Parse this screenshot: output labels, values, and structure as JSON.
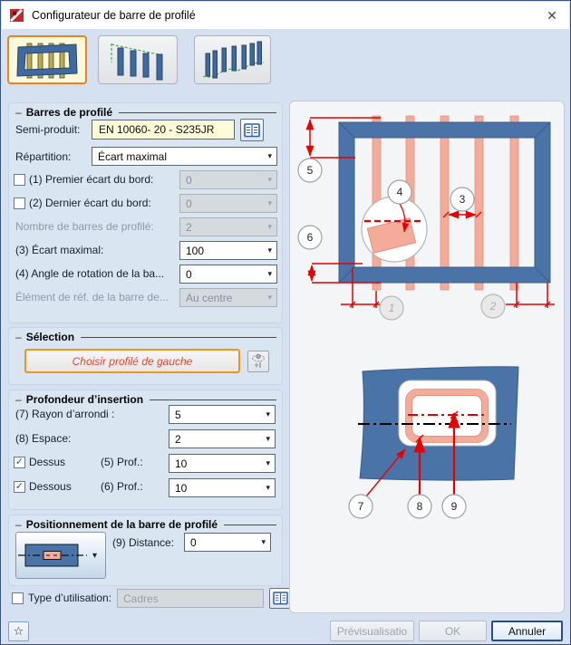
{
  "window": {
    "title": "Configurateur de barre de profilé"
  },
  "icons": {
    "chevron_down": "▾",
    "close": "✕",
    "star": "☆",
    "check": "✓",
    "plus_i": "+I"
  },
  "groups": {
    "bars": {
      "title": "Barres de profilé",
      "semi_product_label": "Semi-produit:",
      "semi_product_value": "EN 10060- 20 - S235JR",
      "repartition_label": "Répartition:",
      "repartition_value": "Écart maximal",
      "first_gap_label": "(1) Premier écart du bord:",
      "first_gap_value": "0",
      "last_gap_label": "(2) Dernier écart du bord:",
      "last_gap_value": "0",
      "count_label": "Nombre de barres de profilé:",
      "count_value": "2",
      "max_gap_label": "(3) Écart maximal:",
      "max_gap_value": "100",
      "angle_label": "(4) Angle de rotation de la ba...",
      "angle_value": "0",
      "ref_label": "Élément de réf. de la barre de...",
      "ref_value": "Au centre"
    },
    "selection": {
      "title": "Sélection",
      "choose_button": "Choisir profilé de gauche"
    },
    "depth": {
      "title": "Profondeur d’insertion",
      "radius_label": "(7) Rayon d’arrondi :",
      "radius_value": "5",
      "space_label": "(8) Espace:",
      "space_value": "2",
      "top_label": "Dessus",
      "top_prof_label": "(5) Prof.:",
      "top_prof_value": "10",
      "bottom_label": "Dessous",
      "bottom_prof_label": "(6) Prof.:",
      "bottom_prof_value": "10"
    },
    "positioning": {
      "title": "Positionnement de la barre de profilé",
      "distance_label": "(9) Distance:",
      "distance_value": "0"
    },
    "usage": {
      "label": "Type d’utilisation:",
      "value": "Cadres"
    }
  },
  "diagram": {
    "c1": "1",
    "c2": "2",
    "c3": "3",
    "c4": "4",
    "c5": "5",
    "c6": "6",
    "c7": "7",
    "c8": "8",
    "c9": "9"
  },
  "footer": {
    "preview": "Prévisualisatio",
    "ok": "OK",
    "cancel": "Annuler"
  },
  "colors": {
    "accent_orange": "#ea8320",
    "frame_blue": "#4a74a8",
    "bar_salmon": "#f5ab99",
    "dimension_red": "#e60000",
    "field_yellow": "#fdfcd9"
  }
}
